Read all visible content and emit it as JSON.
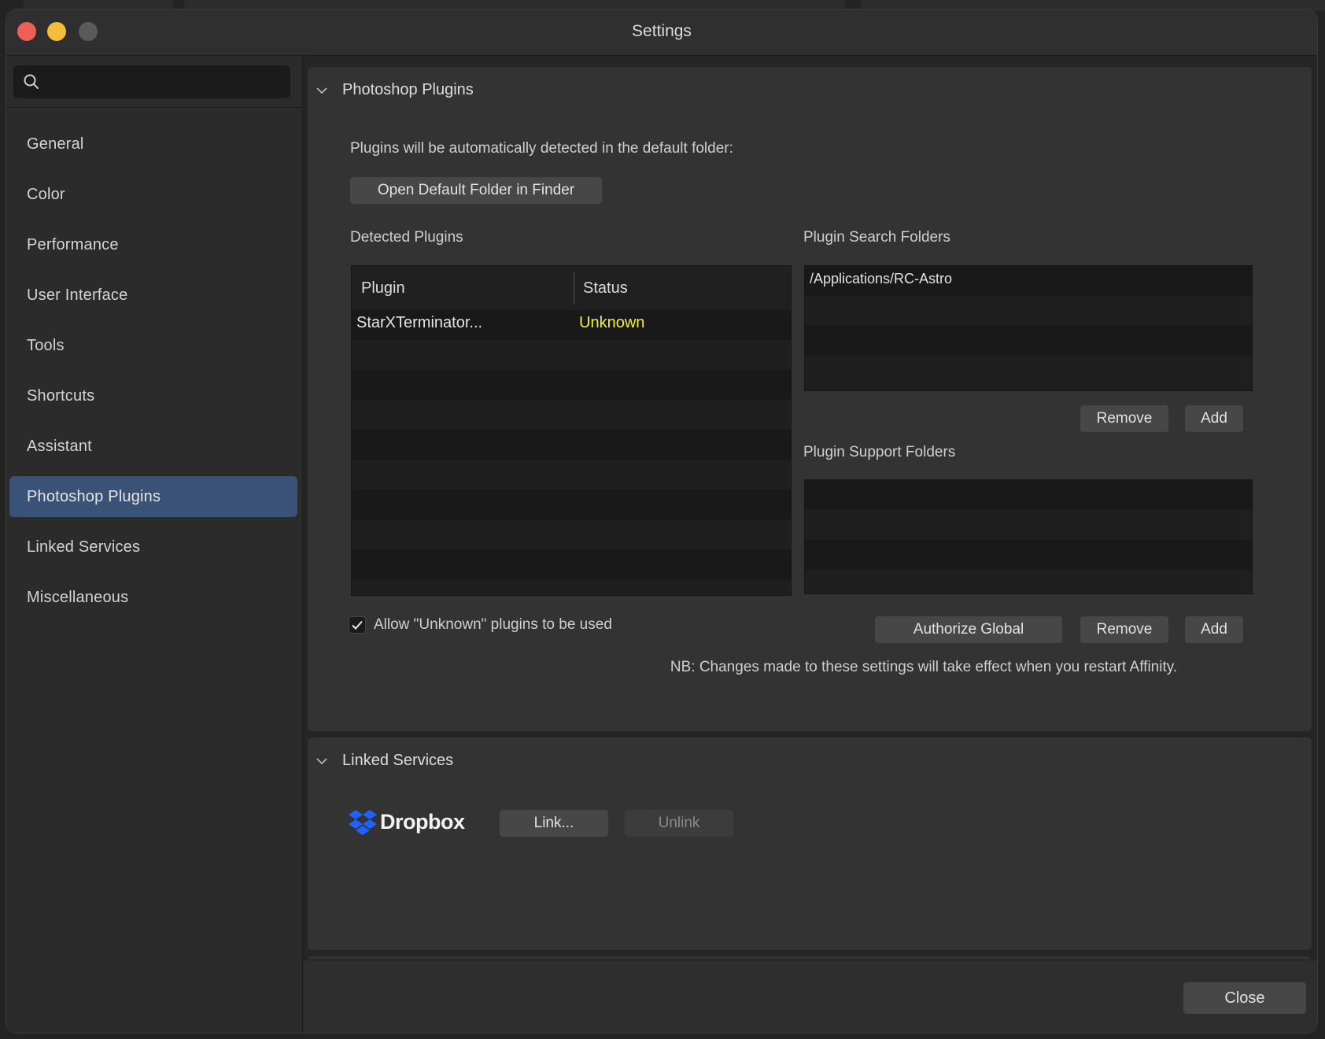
{
  "window": {
    "title": "Settings"
  },
  "search": {
    "placeholder": ""
  },
  "sidebar": {
    "items": [
      {
        "label": "General"
      },
      {
        "label": "Color"
      },
      {
        "label": "Performance"
      },
      {
        "label": "User Interface"
      },
      {
        "label": "Tools"
      },
      {
        "label": "Shortcuts"
      },
      {
        "label": "Assistant"
      },
      {
        "label": "Photoshop Plugins",
        "active": true
      },
      {
        "label": "Linked Services"
      },
      {
        "label": "Miscellaneous"
      }
    ]
  },
  "photoshop_plugins": {
    "title": "Photoshop Plugins",
    "description": "Plugins will be automatically detected in the default folder:",
    "open_folder_label": "Open Default Folder in Finder",
    "detected_title": "Detected Plugins",
    "detected_columns": [
      "Plugin",
      "Status"
    ],
    "detected_rows": [
      {
        "plugin": "StarXTerminator...",
        "status": "Unknown"
      }
    ],
    "status_color": "#f7f035",
    "search_folders_title": "Plugin Search Folders",
    "search_folders": [
      "/Applications/RC-Astro"
    ],
    "support_folders_title": "Plugin Support Folders",
    "support_folders": [],
    "remove_label": "Remove",
    "add_label": "Add",
    "authorize_label": "Authorize Global",
    "allow_unknown_label": "Allow \"Unknown\" plugins to be used",
    "allow_unknown_checked": true,
    "note": "NB: Changes made to these settings will take effect when you restart Affinity."
  },
  "linked_services": {
    "title": "Linked Services",
    "dropbox_label": "Dropbox",
    "dropbox_color": "#1f62fe",
    "link_label": "Link...",
    "unlink_label": "Unlink"
  },
  "footer": {
    "close_label": "Close"
  }
}
